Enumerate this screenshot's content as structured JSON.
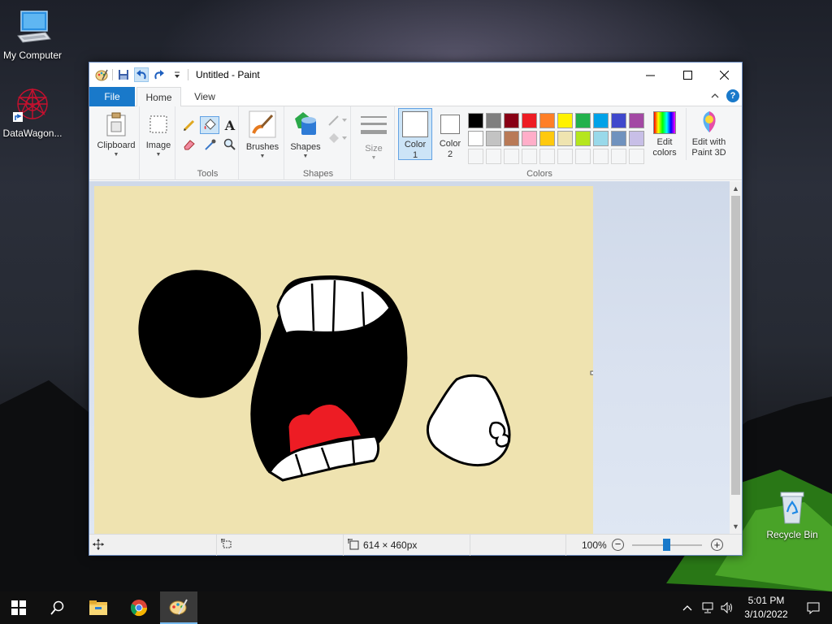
{
  "desktop": {
    "icons": [
      {
        "label": "My Computer"
      },
      {
        "label": "DataWagon..."
      },
      {
        "label": "Recycle Bin"
      }
    ]
  },
  "window": {
    "title": "Untitled - Paint",
    "tabs": {
      "file": "File",
      "home": "Home",
      "view": "View"
    },
    "groups": {
      "clipboard": "Clipboard",
      "image": "Image",
      "tools": "Tools",
      "brushes": "Brushes",
      "shapes_btn": "Shapes",
      "shapes": "Shapes",
      "size": "Size",
      "colors": "Colors"
    },
    "color1": {
      "line1": "Color",
      "line2": "1"
    },
    "color2": {
      "line1": "Color",
      "line2": "2"
    },
    "edit_colors": {
      "line1": "Edit",
      "line2": "colors"
    },
    "edit_paint3d": {
      "line1": "Edit with",
      "line2": "Paint 3D"
    },
    "palette_row1": [
      "#000000",
      "#7f7f7f",
      "#880015",
      "#ed1c24",
      "#ff7f27",
      "#fff200",
      "#22b14c",
      "#00a2e8",
      "#3f48cc",
      "#a349a4"
    ],
    "palette_row2": [
      "#ffffff",
      "#c3c3c3",
      "#b97a57",
      "#ffaec9",
      "#ffc90e",
      "#efe4b0",
      "#b5e61d",
      "#99d9ea",
      "#7092be",
      "#c8bfe7"
    ],
    "canvas_color": "#efe3b0",
    "status": {
      "dimensions": "614 × 460px",
      "zoom": "100%"
    }
  },
  "taskbar": {
    "time": "5:01 PM",
    "date": "3/10/2022"
  }
}
